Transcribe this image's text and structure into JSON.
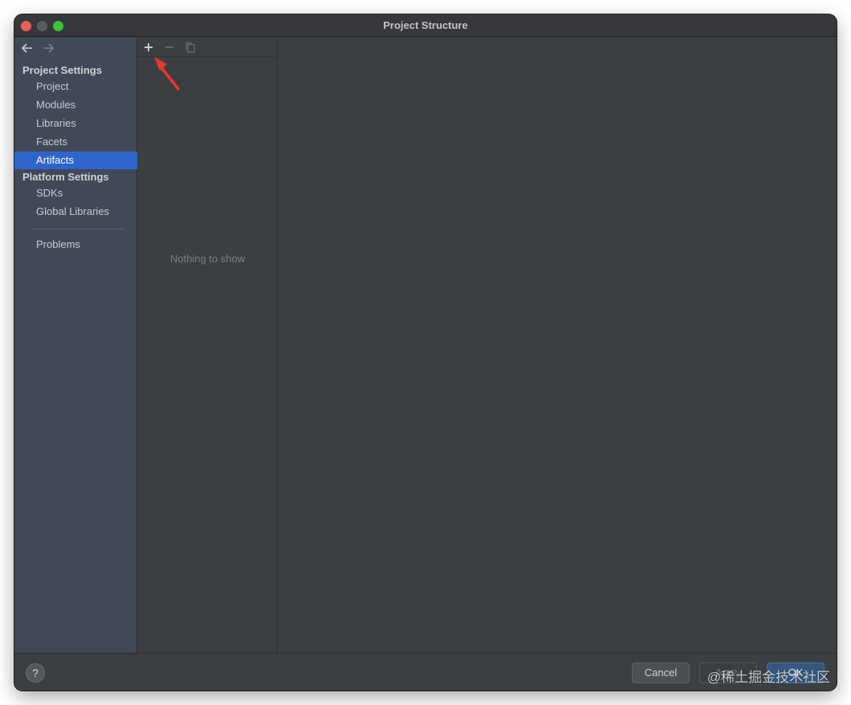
{
  "window": {
    "title": "Project Structure"
  },
  "sidebar": {
    "project_settings_title": "Project Settings",
    "platform_settings_title": "Platform Settings",
    "items": {
      "project": "Project",
      "modules": "Modules",
      "libraries": "Libraries",
      "facets": "Facets",
      "artifacts": "Artifacts",
      "sdks": "SDKs",
      "global_libraries": "Global Libraries",
      "problems": "Problems"
    },
    "selected": "Artifacts"
  },
  "middle": {
    "empty_text": "Nothing to show",
    "toolbar_icons": [
      "plus-icon",
      "minus-icon",
      "copy-icon"
    ]
  },
  "buttons": {
    "help": "?",
    "cancel": "Cancel",
    "apply": "Apply",
    "ok": "OK"
  },
  "watermark": "@稀土掘金技术社区",
  "colors": {
    "sidebar_bg": "#414958",
    "selected_bg": "#2f65ca",
    "panel_bg": "#3c3f41",
    "annotation_arrow": "#e8382b"
  }
}
